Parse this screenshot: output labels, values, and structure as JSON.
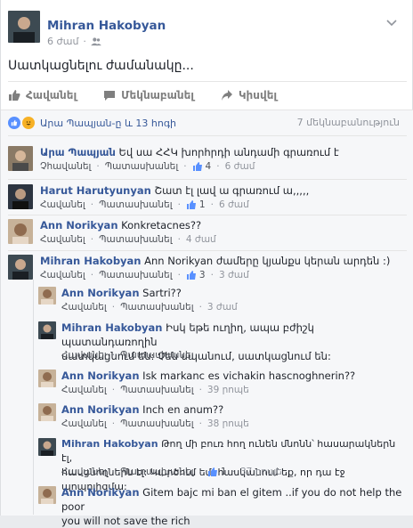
{
  "post": {
    "author": "Mihran Hakobyan",
    "time": "6 ժամ",
    "text": "Սատկացնելու ժամանակը..."
  },
  "actions": {
    "like": "Հավանել",
    "comment": "Մեկնաբանել",
    "share": "Կիսվել"
  },
  "reactions": {
    "summary": "Արա Պապյան-ը և 13 հոգի",
    "seen": "7 մեկնաբանություն"
  },
  "comment_actions": {
    "like": "Հավանել",
    "reply": "Պատասխանել",
    "sep": "·"
  },
  "comments": [
    {
      "author": "Արա Պապյան",
      "text": "Եվ սա ՀՀԿ խորհրդի անդամի գրառում է",
      "like_label": "Չհավանել",
      "likes": "4",
      "time": "6 ժամ"
    },
    {
      "author": "Harut Harutyunyan",
      "text": "Շատ էլ լավ ա գրառում ա,,,,,",
      "like_label": "Հավանել",
      "likes": "1",
      "time": "6 ժամ"
    },
    {
      "author": "Ann Norikyan",
      "text": "Konkretacnes??",
      "like_label": "Հավանել",
      "likes": "",
      "time": "4 ժամ"
    },
    {
      "author": "Mihran Hakobyan",
      "text": "Ann Norikyan ժամերը կյանքս կերան արդեն :)",
      "like_label": "Հավանել",
      "likes": "3",
      "time": "3 ժամ"
    }
  ],
  "replies": [
    {
      "author": "Ann Norikyan",
      "text": "Sartri??",
      "likes": "",
      "time": "3 ժամ"
    },
    {
      "author": "Mihran Hakobyan",
      "text_line1": "Իսկ եթե ուղիղ, ապա բժիշկ պատանդառողին",
      "text_line2": "սատկացնում են: Չեն սպանում, սատկացնում են:",
      "likes": "",
      "time": ""
    },
    {
      "author": "Ann Norikyan",
      "text": "Isk markanc es vichakin hascnoghnerin??",
      "likes": "",
      "time": "39 րոպե"
    },
    {
      "author": "Ann Norikyan",
      "text": "Inch en anum??",
      "likes": "",
      "time": "38 րոպե"
    },
    {
      "author": "Mihran Hakobyan",
      "text_line1": "Թող մի բուռ հող ունեն մնոնն՝ հասարակներն էլ,",
      "text_line2": "հասցնողներն էլ: Կարծում եմ, հասկանում եք, որ դա էջ պոպոլիզմա:",
      "likes": "1",
      "time": "37 րոպե"
    },
    {
      "author": "Ann Norikyan",
      "text_line1": "Gitem bajc mi ban el gitem ..if you do not help the poor",
      "text_line2": "you will not save the rich",
      "likes": "",
      "time": ""
    }
  ],
  "colors": {
    "link": "#365899",
    "like_blue": "#5890ff",
    "haha": "#f7b125"
  }
}
